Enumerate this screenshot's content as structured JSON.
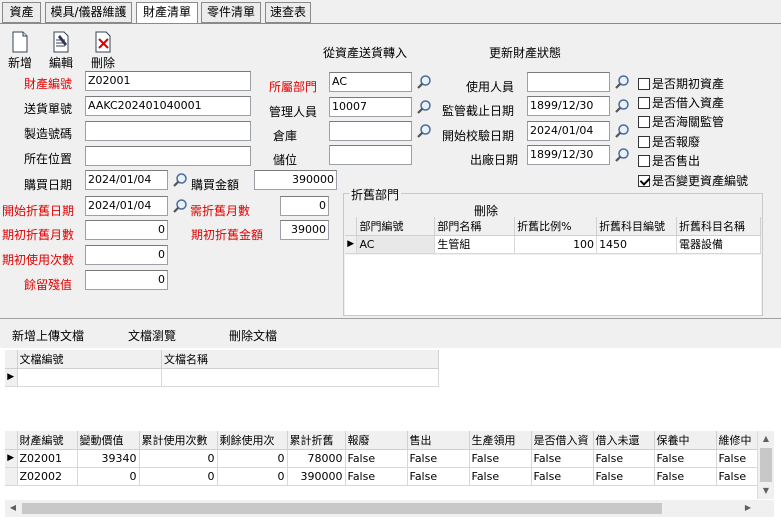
{
  "tabs": [
    "資產",
    "模具/儀器維護",
    "財產清單",
    "零件清單",
    "速查表"
  ],
  "toolbar": {
    "new_label": "新增",
    "edit_label": "編輯",
    "delete_label": "刪除",
    "transfer_label": "從資產送貨轉入",
    "update_status_label": "更新財產狀態"
  },
  "form": {
    "asset_no_label": "財產編號",
    "asset_no": "Z02001",
    "delivery_no_label": "送貨單號",
    "delivery_no": "AAKC202401040001",
    "serial_label": "製造號碼",
    "serial": "",
    "location_label": "所在位置",
    "location": "",
    "purchase_date_label": "購買日期",
    "purchase_date": "2024/01/04",
    "purchase_amount_label": "購買金額",
    "purchase_amount": "390000",
    "dept_label": "所屬部門",
    "dept": "AC",
    "manager_label": "管理人員",
    "manager": "10007",
    "warehouse_label": "倉庫",
    "warehouse": "",
    "bin_label": "儲位",
    "bin": "",
    "user_label": "使用人員",
    "user": "",
    "supervise_end_label": "監管截止日期",
    "supervise_end": "1899/12/30",
    "calib_start_label": "開始校驗日期",
    "calib_start": "2024/01/04",
    "factory_date_label": "出廠日期",
    "factory_date": "1899/12/30",
    "dep_start_label": "開始折舊日期",
    "dep_start": "2024/01/04",
    "dep_months_label": "需折舊月數",
    "dep_months": "0",
    "init_dep_months_label": "期初折舊月數",
    "init_dep_months": "0",
    "init_dep_amount_label": "期初折舊金額",
    "init_dep_amount": "39000",
    "init_use_label": "期初使用次數",
    "init_use": "0",
    "residual_label": "餘留殘值",
    "residual": "0"
  },
  "checks": [
    {
      "label": "是否期初資產",
      "checked": false
    },
    {
      "label": "是否借入資產",
      "checked": false
    },
    {
      "label": "是否海關監管",
      "checked": false
    },
    {
      "label": "是否報廢",
      "checked": false
    },
    {
      "label": "是否售出",
      "checked": false
    },
    {
      "label": "是否變更資產編號",
      "checked": true
    }
  ],
  "dep_dept": {
    "title": "折舊部門",
    "delete_label": "刪除",
    "columns": [
      "部門編號",
      "部門名稱",
      "折舊比例%",
      "折舊科目編號",
      "折舊科目名稱"
    ],
    "rows": [
      [
        "AC",
        "生管組",
        "100",
        "1450",
        "電器設備"
      ]
    ]
  },
  "docs": {
    "upload_label": "新增上傳文檔",
    "browse_label": "文檔瀏覽",
    "delete_label": "刪除文檔",
    "columns": [
      "文檔編號",
      "文檔名稱"
    ]
  },
  "assets_grid": {
    "columns": [
      "財產編號",
      "變動價值",
      "累計使用次數",
      "剩餘使用次",
      "累計折舊",
      "報廢",
      "售出",
      "生產領用",
      "是否借入資",
      "借入未還",
      "保養中",
      "維修中"
    ],
    "rows": [
      [
        "Z02001",
        "39340",
        "0",
        "0",
        "78000",
        "False",
        "False",
        "False",
        "False",
        "False",
        "False",
        "False"
      ],
      [
        "Z02002",
        "0",
        "0",
        "0",
        "390000",
        "False",
        "False",
        "False",
        "False",
        "False",
        "False",
        "False"
      ]
    ]
  }
}
